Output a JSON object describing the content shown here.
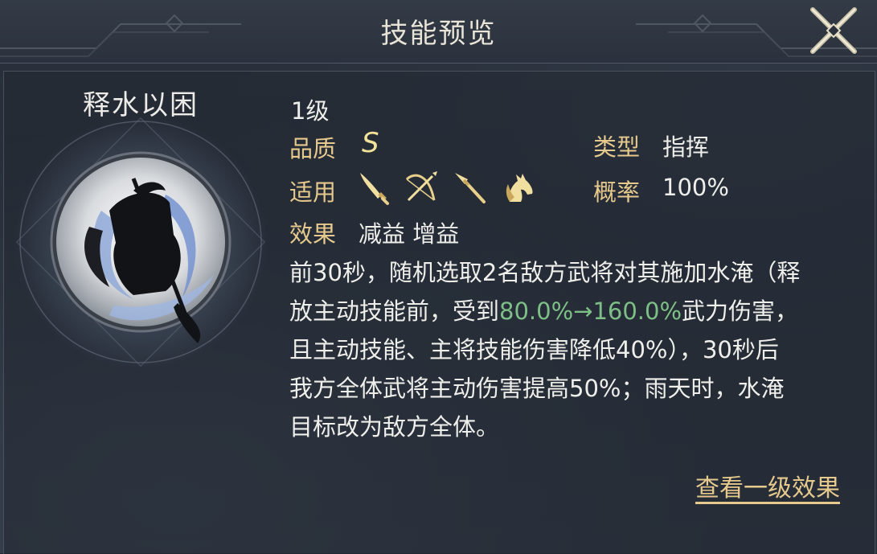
{
  "header": {
    "title": "技能预览"
  },
  "skill": {
    "name": "释水以困",
    "level": "1级",
    "quality_label": "品质",
    "quality_value": "S",
    "type_label": "类型",
    "type_value": "指挥",
    "apply_label": "适用",
    "apply_icons": [
      "saber-icon",
      "bow-icon",
      "spear-icon",
      "horse-icon"
    ],
    "rate_label": "概率",
    "rate_value": "100%",
    "effect_label": "效果",
    "effect_value": "减益 增益"
  },
  "description": {
    "line1": "前30秒，随机选取2名敌方武将对其施加水淹（释",
    "line2_a": "放主动技能前，受到",
    "line2_b": "80.0%→160.0%",
    "line2_c": "武力伤害，",
    "line3": "且主动技能、主将技能伤害降低40%），30秒后",
    "line4": "我方全体武将主动伤害提高50%；雨天时，水淹",
    "line5": "目标改为敌方全体。"
  },
  "footer": {
    "view_level1_link": "查看一级效果"
  },
  "colors": {
    "label_gold": "#e6c98c",
    "highlight_green": "#7dbf86",
    "quality_yellow": "#f3e29a"
  }
}
